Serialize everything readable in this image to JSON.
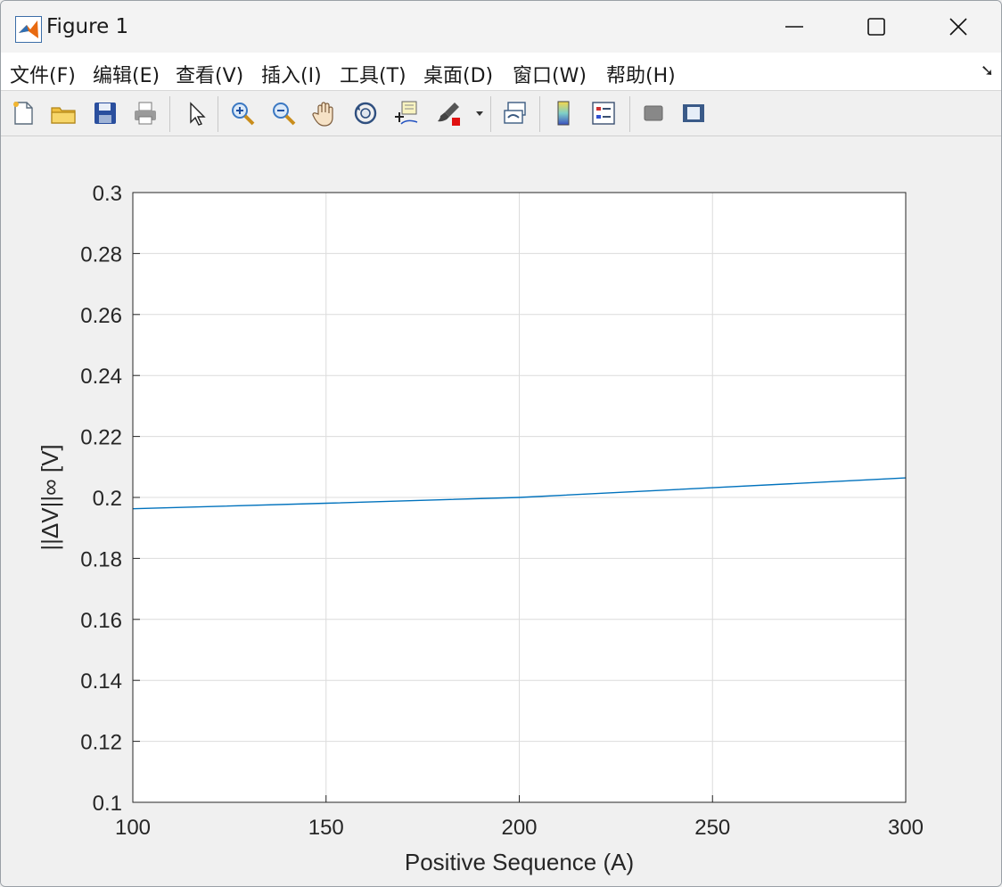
{
  "window": {
    "title": "Figure 1",
    "controls": [
      "minimize",
      "maximize",
      "close"
    ]
  },
  "menubar": {
    "items": [
      "文件(F)",
      "编辑(E)",
      "查看(V)",
      "插入(I)",
      "工具(T)",
      "桌面(D)",
      "窗口(W)",
      "帮助(H)"
    ]
  },
  "toolbar": {
    "icons": [
      "new-file-icon",
      "open-folder-icon",
      "save-icon",
      "print-icon",
      "pointer-icon",
      "zoom-in-icon",
      "zoom-out-icon",
      "pan-hand-icon",
      "rotate-3d-icon",
      "data-cursor-icon",
      "brush-icon",
      "link-plot-icon",
      "colorbar-icon",
      "legend-icon",
      "hide-plot-tools-icon",
      "show-plot-tools-icon"
    ]
  },
  "chart_data": {
    "type": "line",
    "xlabel": "Positive Sequence (A)",
    "ylabel": "||ΔV||∞  [V]",
    "xlim": [
      100,
      300
    ],
    "ylim": [
      0.1,
      0.3
    ],
    "x_ticks": [
      "100",
      "150",
      "200",
      "250",
      "300"
    ],
    "y_ticks": [
      "0.1",
      "0.12",
      "0.14",
      "0.16",
      "0.18",
      "0.2",
      "0.22",
      "0.24",
      "0.26",
      "0.28",
      "0.3"
    ],
    "grid": true,
    "line_color": "#0072BD",
    "x": [
      100,
      150,
      200,
      250,
      300
    ],
    "y": [
      0.1963,
      0.1981,
      0.2,
      0.2032,
      0.2064
    ]
  }
}
